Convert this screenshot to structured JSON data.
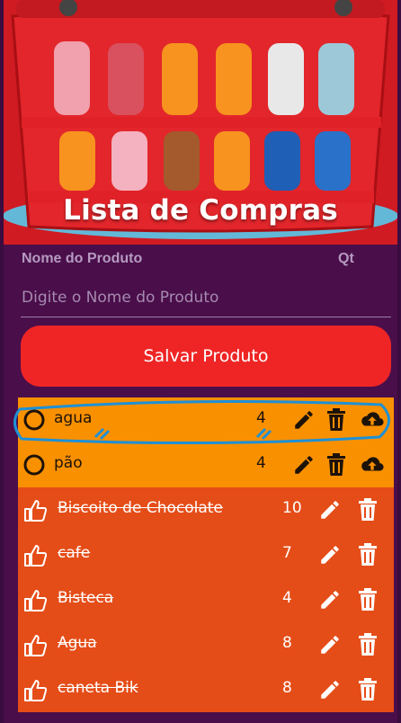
{
  "header": {
    "title": "Lista de Compras"
  },
  "form": {
    "name_label": "Nome do Produto",
    "qty_label": "Qt",
    "name_placeholder": "Digite o Nome do Produto",
    "save_label": "Salvar Produto"
  },
  "items": [
    {
      "name": "agua",
      "qty": "4",
      "done": false
    },
    {
      "name": "pão",
      "qty": "4",
      "done": false
    },
    {
      "name": "Biscoito de Chocolate",
      "qty": "10",
      "done": true
    },
    {
      "name": "cafe",
      "qty": "7",
      "done": true
    },
    {
      "name": "Bisteca",
      "qty": "4",
      "done": true
    },
    {
      "name": "Agua",
      "qty": "8",
      "done": true
    },
    {
      "name": "caneta Bik",
      "qty": "8",
      "done": true
    }
  ],
  "colors": {
    "background": "#4a0e4a",
    "button": "#ef2525",
    "pending_row": "#f99000",
    "done_row": "#e54d18",
    "annotation": "#1e90d6"
  },
  "icons": {
    "pending_status": "circle-outline-icon",
    "done_status": "thumbs-up-icon",
    "edit": "pencil-icon",
    "delete": "trash-icon",
    "upload": "cloud-upload-icon"
  }
}
